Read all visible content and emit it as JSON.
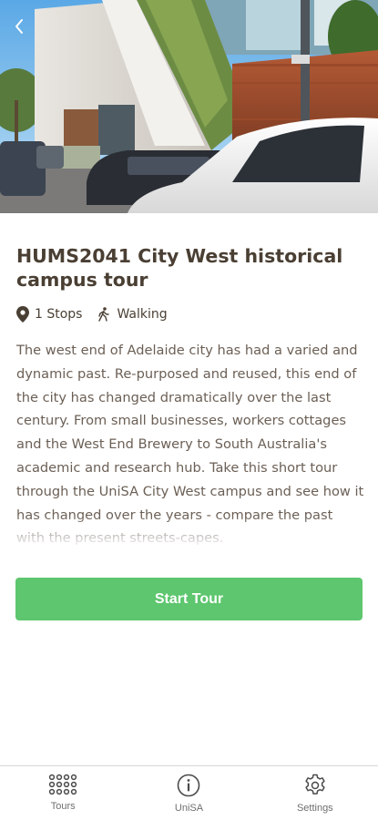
{
  "tour": {
    "title": "HUMS2041 City West historical campus tour",
    "stops": "1 Stops",
    "mode": "Walking",
    "description": "The west end of Adelaide city has had a varied and dynamic past. Re-purposed and reused, this end of the city has changed dramatically over the last century. From small businesses, workers cottages and the West End Brewery to South Australia's academic and research hub. Take this short tour through the UniSA City West campus and see how it has changed over the years - compare the past with the present streets-capes.",
    "start_label": "Start Tour",
    "accent_color": "#5dc66e"
  },
  "nav": {
    "items": [
      {
        "label": "Tours",
        "icon": "grid-icon"
      },
      {
        "label": "UniSA",
        "icon": "info-icon"
      },
      {
        "label": "Settings",
        "icon": "gear-icon"
      }
    ]
  },
  "icons": {
    "back": "chevron-left-icon",
    "stops": "map-pin-icon",
    "mode": "walking-icon"
  }
}
